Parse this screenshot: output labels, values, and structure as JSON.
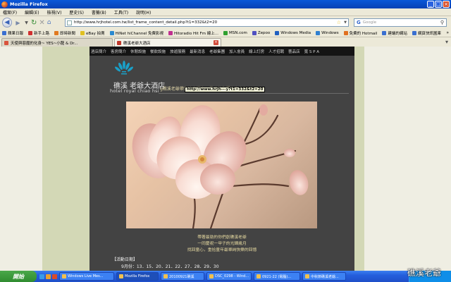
{
  "window": {
    "title": "Mozilla Firefox"
  },
  "menu": [
    "檔案(F)",
    "編輯(E)",
    "檢視(V)",
    "歷史(S)",
    "書籤(B)",
    "工具(T)",
    "說明(H)"
  ],
  "nav": {
    "url": "http://www.hrjhotel.com.tw/list_frame_content_detail.php?t1=332&t2=20",
    "search_placeholder": "Google"
  },
  "bookmarks": [
    {
      "label": "蘋果日報",
      "color": "#3a6fd0"
    },
    {
      "label": "新手上路",
      "color": "#d03030"
    },
    {
      "label": "即時新聞",
      "color": "#e07a20"
    },
    {
      "label": "eBay 拍賣",
      "color": "#e0c020"
    },
    {
      "label": "HiNet hiChannel 免費影視",
      "color": "#2a8ad0"
    },
    {
      "label": "Hitoradio Hit Fm 線上...",
      "color": "#c03090"
    },
    {
      "label": "MSN.com",
      "color": "#30a030"
    },
    {
      "label": "Zepoo",
      "color": "#5050c0"
    },
    {
      "label": "Windows Media",
      "color": "#2060c0"
    },
    {
      "label": "Windows",
      "color": "#3080d0"
    },
    {
      "label": "免費的 Hotmail",
      "color": "#e07020"
    },
    {
      "label": "建議的網站",
      "color": "#3a6fd0"
    },
    {
      "label": "網頁快訊圖庫",
      "color": "#3a6fd0"
    }
  ],
  "tabs": [
    {
      "label": "天使與惡魔的化身~ YES~小龍 & Dr...",
      "active": false
    },
    {
      "label": "礁溪老爺大酒店",
      "active": true
    }
  ],
  "tooltip": "http://www.hrjh---y?t1=332&t2=20",
  "site": {
    "nav": [
      "酒店簡介",
      "客房簡介",
      "休閒設施",
      "餐飲設施",
      "旅遊服務",
      "最新消息",
      "老爺集團",
      "加入會員",
      "線上訂房",
      "人才招聘",
      "藝品店",
      "寬 S P A"
    ],
    "logo_cn": "礁溪 老爺大酒店",
    "logo_en": "hotel royal chiao hsi",
    "tagline": "g礁溪老爺帶您追老獵童！最勁的你獨享兒童價！！g",
    "caption": [
      "帶著最勁的你們創礁溪老爺",
      "一同慶祝一甲子的光輝歲月",
      "找回童心，重拾童年最單純快樂的回憶"
    ],
    "dates_heading": "【活動日期】",
    "dates": "9月份：13．15．20．21．22．27．28．29．30"
  },
  "taskbar": {
    "start": "開始",
    "items": [
      {
        "label": "Windows Live Mes...",
        "active": false
      },
      {
        "label": "Mozilla Firefox",
        "active": true
      },
      {
        "label": "20100921礁溪",
        "active": false
      },
      {
        "label": "DSC_0298 - Wind...",
        "active": false
      },
      {
        "label": "0921-22 (電腦)...",
        "active": false
      },
      {
        "label": "中秋節礁溪老爺...",
        "active": false
      }
    ]
  },
  "watermark": "礁溪老爺"
}
